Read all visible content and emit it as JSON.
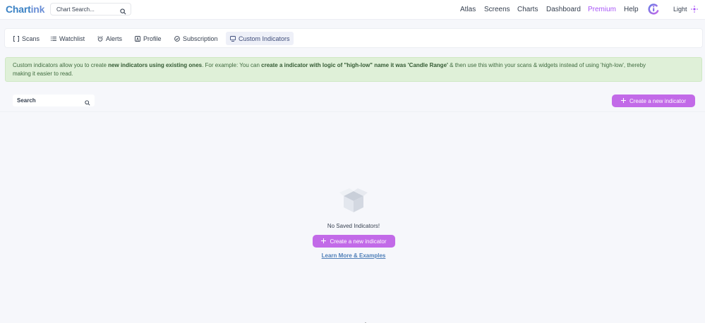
{
  "app": {
    "logo_part1": "Chart",
    "logo_part2": "ink"
  },
  "header": {
    "search_placeholder": "Chart Search...",
    "nav": [
      {
        "label": "Atlas"
      },
      {
        "label": "Screens"
      },
      {
        "label": "Charts"
      },
      {
        "label": "Dashboard"
      },
      {
        "label": "Premium"
      },
      {
        "label": "Help"
      }
    ],
    "theme_label": "Light"
  },
  "tabs": [
    {
      "label": "Scans",
      "icon": "scan-icon"
    },
    {
      "label": "Watchlist",
      "icon": "list-icon"
    },
    {
      "label": "Alerts",
      "icon": "alarm-icon"
    },
    {
      "label": "Profile",
      "icon": "profile-icon"
    },
    {
      "label": "Subscription",
      "icon": "check-circle-icon"
    },
    {
      "label": "Custom Indicators",
      "icon": "indicator-icon",
      "active": true
    }
  ],
  "banner": {
    "t1": "Custom indicators allow you to create ",
    "b1": "new indicators using existing ones",
    "t2": ". For example: You can ",
    "b2": "create a indicator with logic of \"high-low\" name it was 'Candle Range'",
    "t3": " & then use this within your scans & widgets instead of using 'high-low', thereby",
    "t4": "making it easier to read."
  },
  "toolbar": {
    "search_placeholder": "Search",
    "create_label": "Create a new indicator"
  },
  "empty_state": {
    "title": "No Saved Indicators!",
    "create_label": "Create a new indicator",
    "learn_more": "Learn More & Examples"
  },
  "colors": {
    "accent": "#c26ae8",
    "premium": "#a855f7",
    "banner_bg": "#dff0d8",
    "link": "#4f7fb8"
  }
}
